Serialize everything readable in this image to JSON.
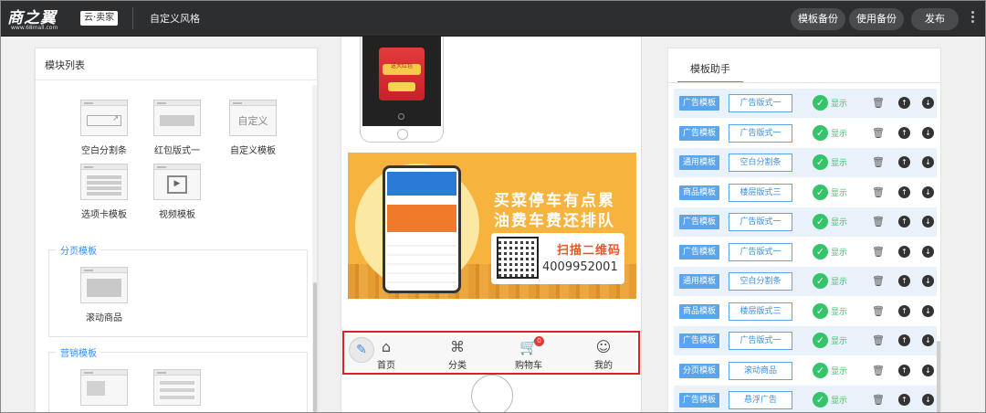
{
  "header": {
    "logo_text": "商之翼",
    "logo_url": "www.68mall.com",
    "seller_label": "云·卖家",
    "page_title": "自定义风格",
    "buttons": {
      "template_backup": "模板备份",
      "use_backup": "使用备份",
      "publish": "发布"
    }
  },
  "left_panel": {
    "title": "模块列表",
    "top_modules": [
      {
        "label": "空白分割条",
        "icon": "blank-divider-icon"
      },
      {
        "label": "红包版式一",
        "icon": "red-packet-icon"
      },
      {
        "label": "自定义模板",
        "icon": "custom-template-icon",
        "thumb_text": "自定义"
      },
      {
        "label": "选项卡模板",
        "icon": "tab-template-icon"
      },
      {
        "label": "视频模板",
        "icon": "video-template-icon"
      }
    ],
    "groups": [
      {
        "label": "分页模板",
        "modules": [
          {
            "label": "滚动商品",
            "icon": "scroll-goods-icon"
          }
        ]
      },
      {
        "label": "营销模板",
        "modules": [
          {
            "label": "",
            "icon": "marketing-icon"
          },
          {
            "label": "",
            "icon": "marketing-list-icon"
          }
        ]
      }
    ]
  },
  "preview": {
    "redpack_text": "送大红包",
    "banner": {
      "slogan1": "买菜停车有点累",
      "slogan2": "油费车费还排队",
      "scan": "扫描二维码",
      "phone": "4009952001"
    },
    "tabbar": [
      {
        "label": "首页",
        "icon": "home-icon"
      },
      {
        "label": "分类",
        "icon": "category-icon"
      },
      {
        "label": "购物车",
        "icon": "cart-icon",
        "badge": "0"
      },
      {
        "label": "我的",
        "icon": "user-icon"
      }
    ]
  },
  "right_panel": {
    "tab": "模板助手",
    "rows": [
      {
        "type": "广告模板",
        "style": "广告版式一",
        "status": "显示"
      },
      {
        "type": "广告模板",
        "style": "广告版式一",
        "status": "显示"
      },
      {
        "type": "通用模板",
        "style": "空白分割条",
        "status": "显示"
      },
      {
        "type": "商品模板",
        "style": "楼层版式三",
        "status": "显示"
      },
      {
        "type": "广告模板",
        "style": "广告版式一",
        "status": "显示"
      },
      {
        "type": "广告模板",
        "style": "广告版式一",
        "status": "显示"
      },
      {
        "type": "通用模板",
        "style": "空白分割条",
        "status": "显示"
      },
      {
        "type": "商品模板",
        "style": "楼层版式三",
        "status": "显示"
      },
      {
        "type": "广告模板",
        "style": "广告版式一",
        "status": "显示"
      },
      {
        "type": "分页模板",
        "style": "滚动商品",
        "status": "显示"
      },
      {
        "type": "广告模板",
        "style": "悬浮广告",
        "status": "显示"
      }
    ]
  },
  "colors": {
    "topbar": "#2d2e30",
    "accent_blue": "#3a8ee6",
    "show_green": "#36c46a",
    "highlight_red": "#d8232a",
    "banner_orange": "#f6b33d"
  }
}
